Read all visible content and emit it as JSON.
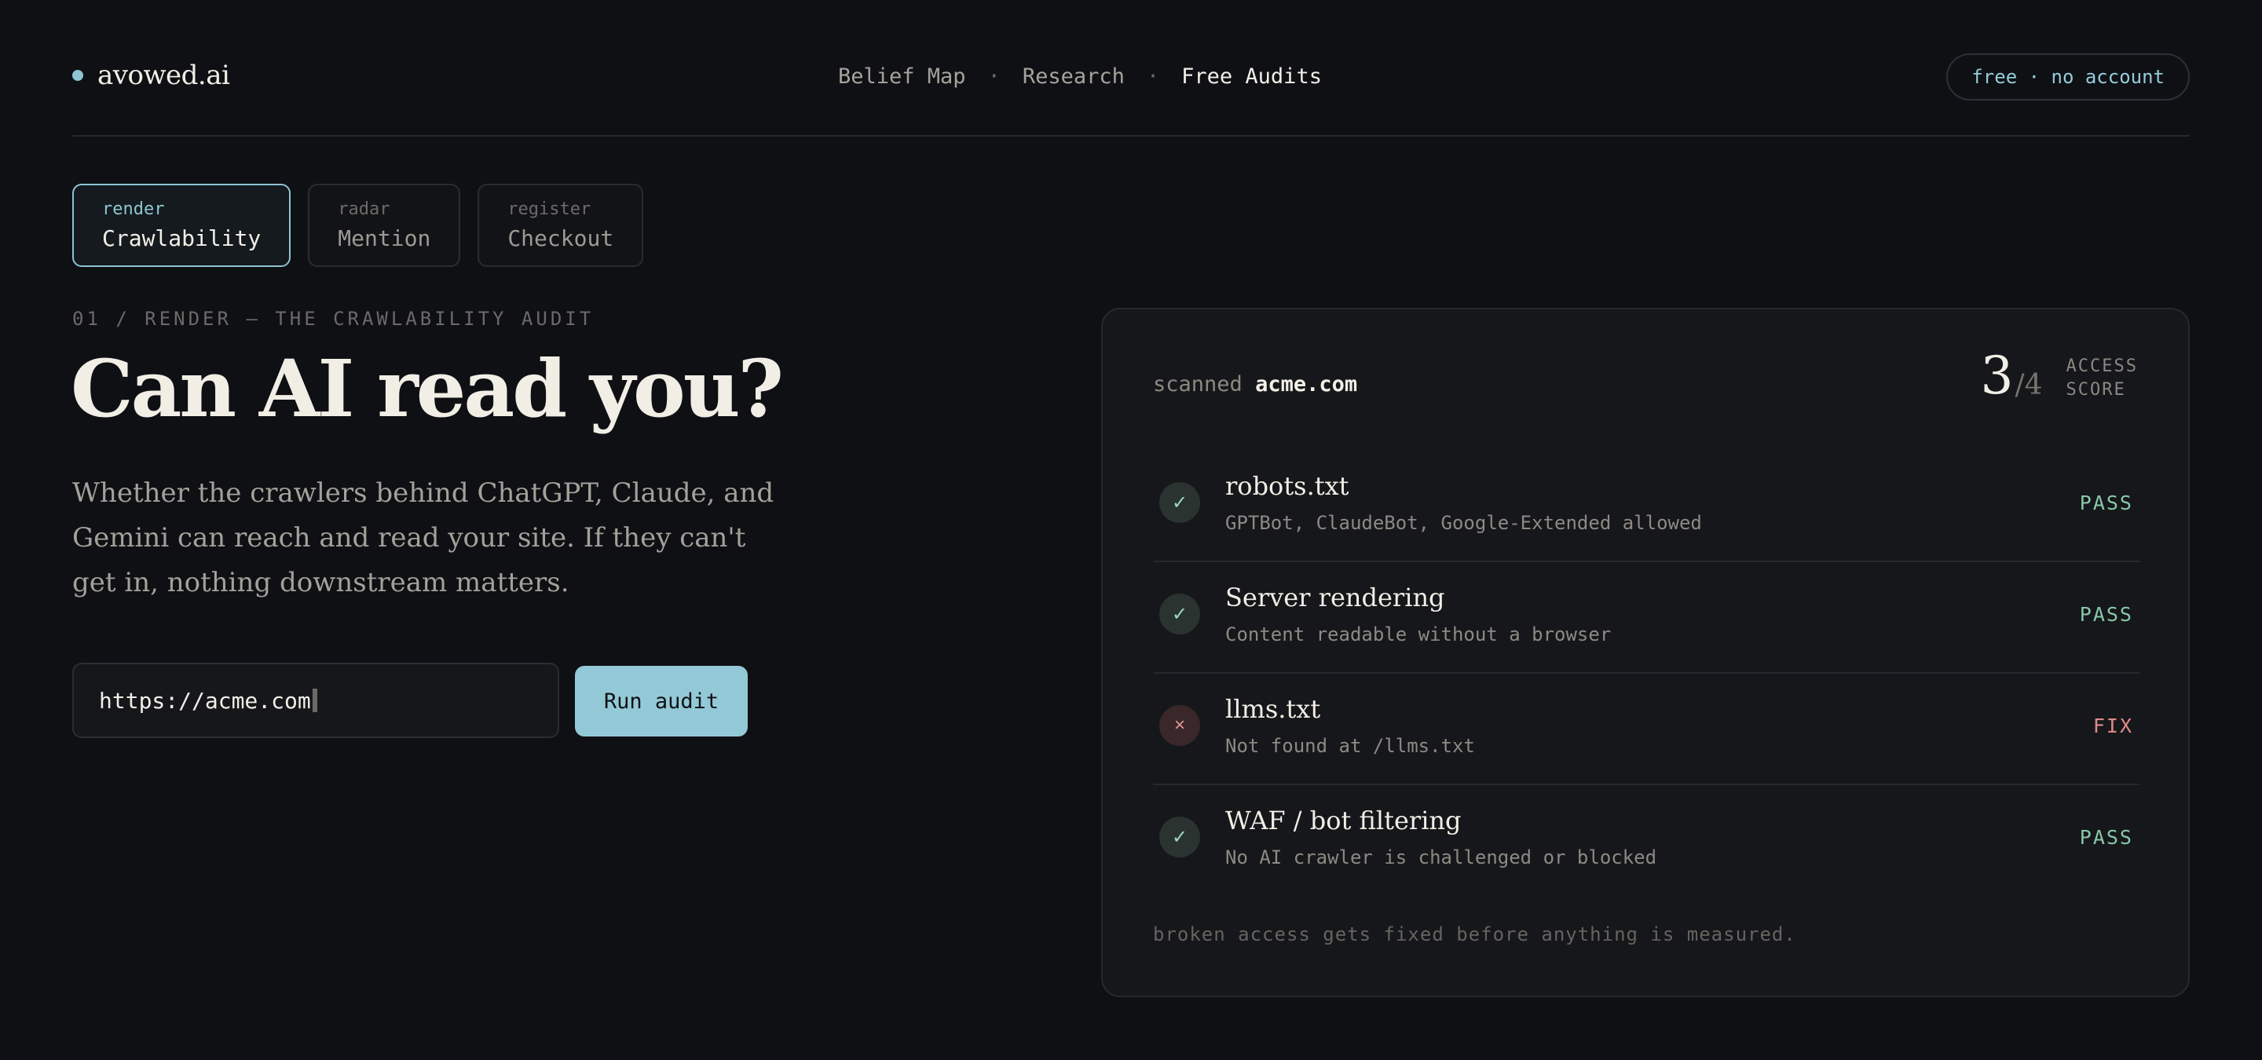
{
  "header": {
    "brand": "avowed.ai",
    "nav": [
      {
        "label": "Belief Map",
        "active": false
      },
      {
        "label": "Research",
        "active": false
      },
      {
        "label": "Free Audits",
        "active": true
      }
    ],
    "separator": "·",
    "pill": "free · no account"
  },
  "tabs": [
    {
      "kicker": "render",
      "label": "Crawlability",
      "active": true
    },
    {
      "kicker": "radar",
      "label": "Mention",
      "active": false
    },
    {
      "kicker": "register",
      "label": "Checkout",
      "active": false
    }
  ],
  "hero": {
    "eyebrow": "01 / RENDER — THE CRAWLABILITY AUDIT",
    "headline": "Can AI read you?",
    "lede": "Whether the crawlers behind ChatGPT, Claude, and Gemini can reach and read your site. If they can't get in, nothing downstream matters.",
    "input_value": "https://acme.com",
    "run_label": "Run audit"
  },
  "card": {
    "scanned_label": "scanned",
    "scanned_host": "acme.com",
    "score": "3",
    "score_total": "/4",
    "score_label_1": "ACCESS",
    "score_label_2": "SCORE",
    "checks": [
      {
        "icon": "check-icon",
        "glyph": "✓",
        "title": "robots.txt",
        "desc": "GPTBot, ClaudeBot, Google-Extended allowed",
        "status": "PASS"
      },
      {
        "icon": "check-icon",
        "glyph": "✓",
        "title": "Server rendering",
        "desc": "Content readable without a browser",
        "status": "PASS"
      },
      {
        "icon": "x-icon",
        "glyph": "×",
        "title": "llms.txt",
        "desc": "Not found at /llms.txt",
        "status": "FIX"
      },
      {
        "icon": "check-icon",
        "glyph": "✓",
        "title": "WAF / bot filtering",
        "desc": "No AI crawler is challenged or blocked",
        "status": "PASS"
      }
    ],
    "footnote": "broken access gets fixed before anything is measured."
  },
  "colors": {
    "background": "#0f1014",
    "accent": "#8ec4d4",
    "pass": "#86c9a9",
    "fix": "#e08a8a"
  }
}
